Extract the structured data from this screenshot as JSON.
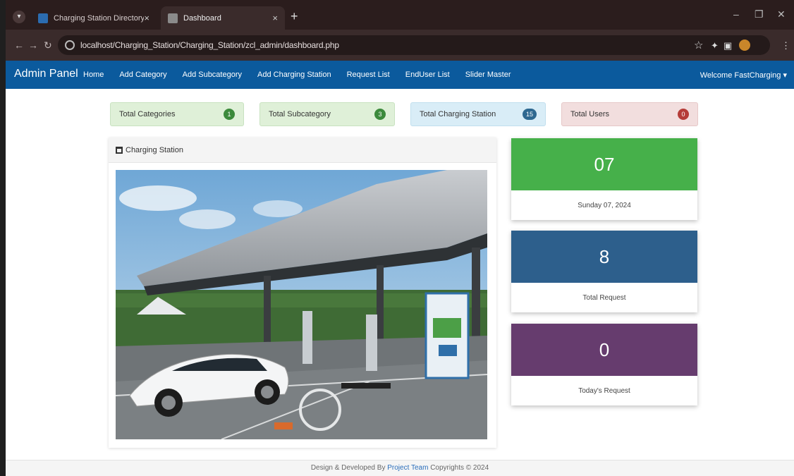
{
  "browser": {
    "tabs": [
      {
        "title": "Charging Station Directory",
        "close": "×"
      },
      {
        "title": "Dashboard",
        "close": "×"
      }
    ],
    "new_tab": "+",
    "url": "localhost/Charging_Station/Charging_Station/zcl_admin/dashboard.php"
  },
  "navbar": {
    "brand": "Admin Panel",
    "links": [
      "Home",
      "Add Category",
      "Add Subcategory",
      "Add Charging Station",
      "Request List",
      "EndUser List",
      "Slider Master"
    ],
    "welcome": "Welcome FastCharging ▾"
  },
  "stats": [
    {
      "label": "Total Categories",
      "count": "1",
      "color": "#dff0d8"
    },
    {
      "label": "Total Subcategory",
      "count": "3",
      "color": "#dff0d8"
    },
    {
      "label": "Total Charging Station",
      "count": "15",
      "color": "#d9edf7"
    },
    {
      "label": "Total Users",
      "count": "0",
      "color": "#f2dede"
    }
  ],
  "panel": {
    "title": "Charging Station"
  },
  "cards": [
    {
      "value": "07",
      "caption": "Sunday 07, 2024",
      "color": "#46b04a"
    },
    {
      "value": "8",
      "caption": "Total Request",
      "color": "#2d5f8c"
    },
    {
      "value": "0",
      "caption": "Today's Request",
      "color": "#663c6e"
    }
  ],
  "footer": {
    "prefix": "Design & Developed By ",
    "link": "Project Team",
    "suffix": " Copyrights © 2024"
  }
}
